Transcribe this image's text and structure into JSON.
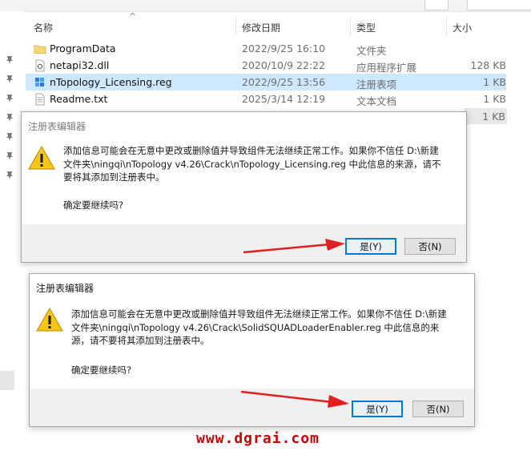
{
  "explorer": {
    "columns": {
      "name": "名称",
      "date": "修改日期",
      "type": "类型",
      "size": "大小"
    },
    "files": [
      {
        "name": "ProgramData",
        "date": "2022/9/25 16:10",
        "type": "文件夹",
        "size": "",
        "icon": "folder-icon",
        "selected": false
      },
      {
        "name": "netapi32.dll",
        "date": "2020/10/9 22:22",
        "type": "应用程序扩展",
        "size": "128 KB",
        "icon": "dll-file-icon",
        "selected": false
      },
      {
        "name": "nTopology_Licensing.reg",
        "date": "2022/9/25 13:56",
        "type": "注册表项",
        "size": "1 KB",
        "icon": "registry-file-icon",
        "selected": true
      },
      {
        "name": "Readme.txt",
        "date": "2025/3/14 12:19",
        "type": "文本文档",
        "size": "1 KB",
        "icon": "text-file-icon",
        "selected": false
      }
    ],
    "hidden_row_size": "1 KB"
  },
  "dialog1": {
    "title": "注册表编辑器",
    "message_lines": [
      "添加信息可能会在无意中更改或删除值并导致组件无法继续正常工作。如果你不信任 D:\\新建",
      "文件夹\\ningqi\\nTopology v4.26\\Crack\\nTopology_Licensing.reg 中此信息的来源，请不",
      "要将其添加到注册表中。"
    ],
    "confirm": "确定要继续吗?",
    "yes": "是(Y)",
    "no": "否(N)"
  },
  "dialog2": {
    "title": "注册表编辑器",
    "message_lines": [
      "添加信息可能会在无意中更改或删除值并导致组件无法继续正常工作。如果你不信任 D:\\新建",
      "文件夹\\ningqi\\nTopology v4.26\\Crack\\SolidSQUADLoaderEnabler.reg 中此信息的来",
      "源，请不要将其添加到注册表中。"
    ],
    "confirm": "确定要继续吗?",
    "yes": "是(Y)",
    "no": "否(N)"
  },
  "watermark": "www.dgrai.com",
  "colors": {
    "selection": "#cde8ff",
    "accent": "#0078d7",
    "arrow": "#e02020",
    "watermark": "#cc0000"
  }
}
